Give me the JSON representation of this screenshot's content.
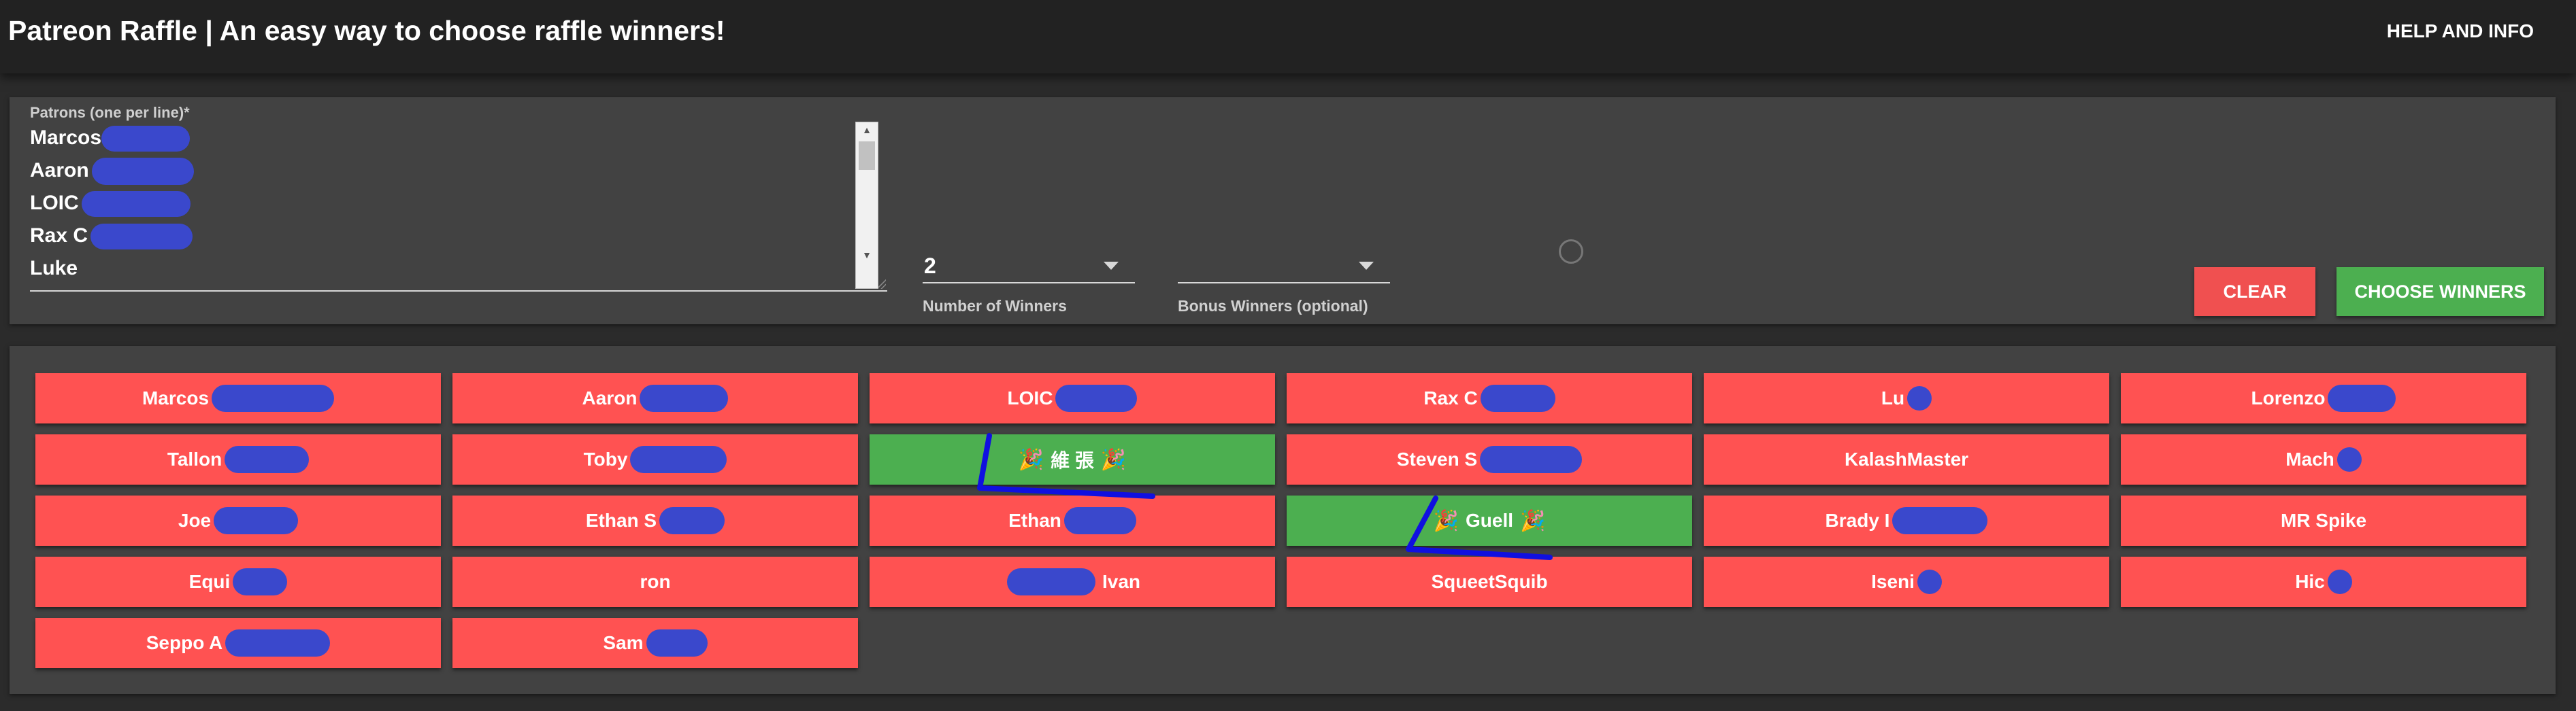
{
  "header": {
    "title": "Patreon Raffle | An easy way to choose raffle winners!",
    "help_label": "HELP AND INFO"
  },
  "form": {
    "patrons_label": "Patrons (one per line)*",
    "patrons_lines": [
      "Marcos",
      "Aaron",
      "LOIC",
      "Rax C",
      "Luke"
    ],
    "num_winners_value": "2",
    "num_winners_label": "Number of Winners",
    "bonus_winners_value": "",
    "bonus_winners_label": "Bonus Winners (optional)",
    "clear_label": "CLEAR",
    "choose_label": "CHOOSE WINNERS"
  },
  "results": {
    "chips": [
      {
        "name": "Marcos",
        "winner": false
      },
      {
        "name": "Aaron",
        "winner": false
      },
      {
        "name": "LOIC",
        "winner": false
      },
      {
        "name": "Rax C",
        "winner": false
      },
      {
        "name": "Lu",
        "winner": false
      },
      {
        "name": "Lorenzo",
        "winner": false
      },
      {
        "name": "Tallon",
        "winner": false
      },
      {
        "name": "Toby",
        "winner": false
      },
      {
        "name": "維 張",
        "winner": true
      },
      {
        "name": "Steven S",
        "winner": false
      },
      {
        "name": "KalashMaster",
        "winner": false
      },
      {
        "name": "Mach",
        "winner": false
      },
      {
        "name": "Joe",
        "winner": false
      },
      {
        "name": "Ethan S",
        "winner": false
      },
      {
        "name": "Ethan",
        "winner": false
      },
      {
        "name": "Guell",
        "winner": true
      },
      {
        "name": "Brady I",
        "winner": false
      },
      {
        "name": "MR Spike",
        "winner": false
      },
      {
        "name": "Equi",
        "winner": false
      },
      {
        "name": "ron",
        "winner": false
      },
      {
        "name": "Ivan",
        "winner": false
      },
      {
        "name": "SqueetSquib",
        "winner": false
      },
      {
        "name": "Iseni",
        "winner": false
      },
      {
        "name": "Hic",
        "winner": false
      },
      {
        "name": "Seppo A",
        "winner": false
      },
      {
        "name": "Sam",
        "winner": false
      }
    ]
  },
  "colors": {
    "chip_default": "#ff5252",
    "chip_winner": "#4caf50",
    "redaction": "#3a48cc",
    "scribble": "#1010e0"
  },
  "icons": {
    "winner_marker": "party-popper-icon"
  }
}
